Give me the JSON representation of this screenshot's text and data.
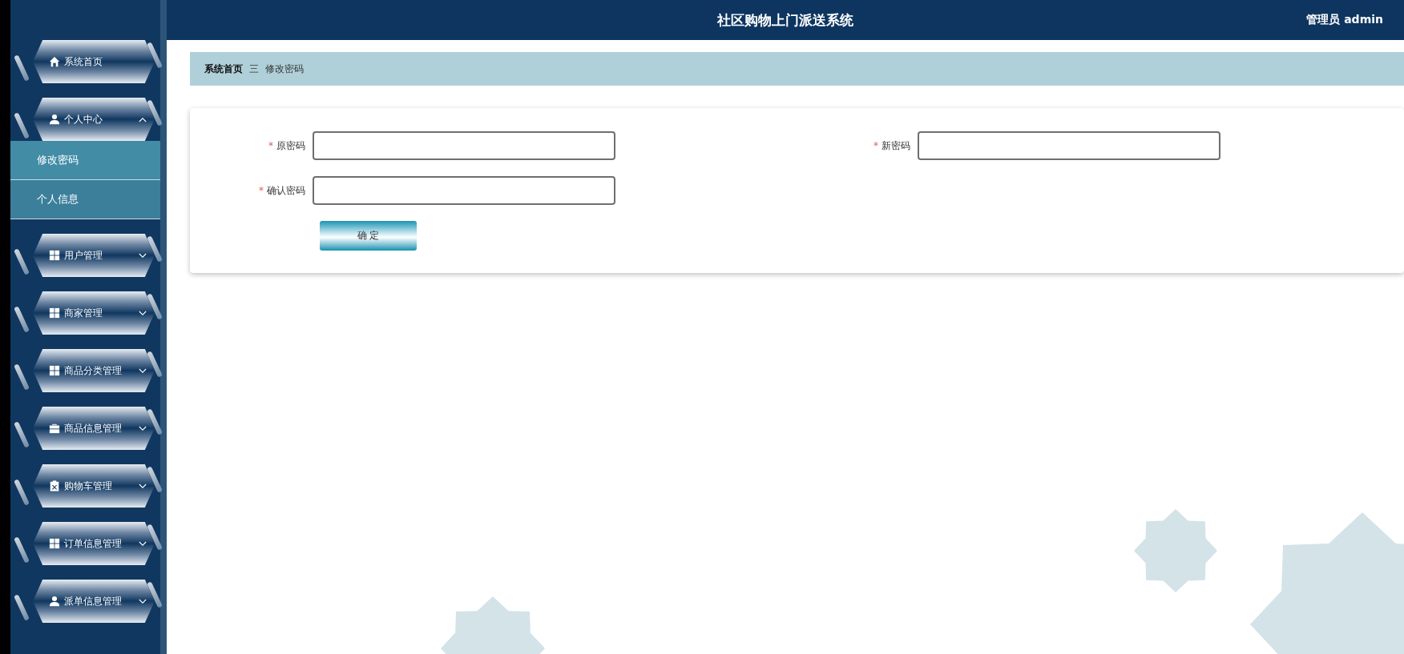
{
  "header": {
    "title": "社区购物上门派送系统",
    "user": "管理员 admin"
  },
  "sidebar": {
    "items": [
      {
        "label": "系统首页",
        "kind": "link"
      },
      {
        "label": "个人中心",
        "kind": "group",
        "expanded": true,
        "children": [
          {
            "label": "修改密码",
            "selected": true
          },
          {
            "label": "个人信息",
            "selected": false
          }
        ]
      },
      {
        "label": "用户管理",
        "kind": "group",
        "expanded": false
      },
      {
        "label": "商家管理",
        "kind": "group",
        "expanded": false
      },
      {
        "label": "商品分类管理",
        "kind": "group",
        "expanded": false
      },
      {
        "label": "商品信息管理",
        "kind": "group",
        "expanded": false
      },
      {
        "label": "购物车管理",
        "kind": "group",
        "expanded": false
      },
      {
        "label": "订单信息管理",
        "kind": "group",
        "expanded": false
      },
      {
        "label": "派单信息管理",
        "kind": "group",
        "expanded": false
      }
    ]
  },
  "breadcrumb": {
    "items": [
      "系统首页",
      "修改密码"
    ],
    "separator": "三"
  },
  "form": {
    "required_mark": "*",
    "fields": [
      {
        "label": "原密码",
        "required": true
      },
      {
        "label": "新密码",
        "required": true
      },
      {
        "label": "确认密码",
        "required": true
      }
    ],
    "submit": "确 定"
  }
}
